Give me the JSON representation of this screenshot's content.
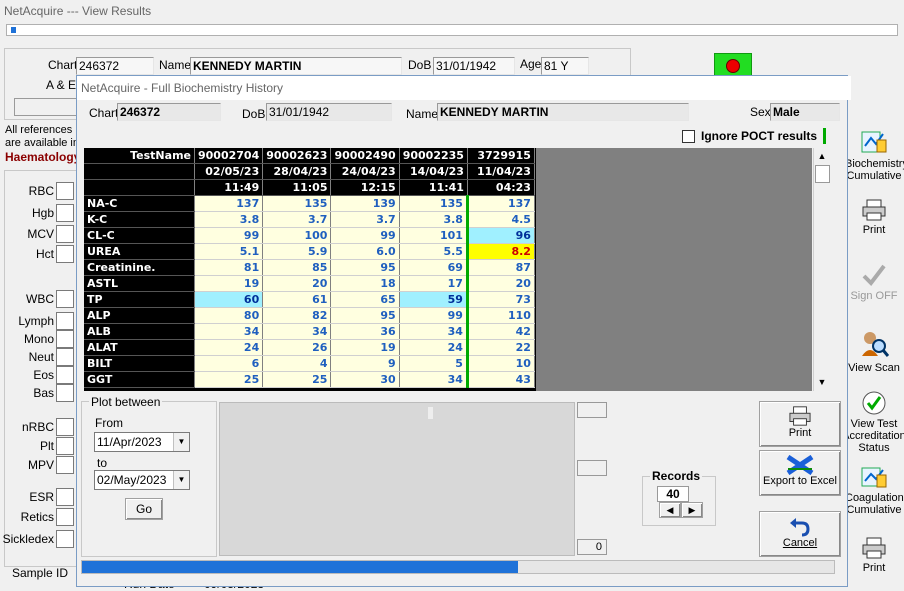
{
  "main_window": {
    "title": "NetAcquire --- View Results",
    "chart_label": "Chart",
    "chart_value": "246372",
    "name_label": "Name",
    "name_value": "KENNEDY MARTIN",
    "dob_label": "DoB",
    "dob_value": "31/01/1942",
    "age_label": "Age",
    "age_value": "81 Y",
    "ae_label": "A & E",
    "refs_line1": "All references n",
    "refs_line2": "are available in",
    "haematology_label": "Haematology",
    "haem_labels": [
      "RBC",
      "Hgb",
      "MCV",
      "Hct",
      "WBC",
      "Lymph",
      "Mono",
      "Neut",
      "Eos",
      "Bas",
      "nRBC",
      "Plt",
      "MPV",
      "ESR",
      "Retics",
      "Sickledex"
    ],
    "sample_id_label": "Sample ID",
    "run_date_label": "Run Date",
    "run_date_value": "09/05/2023",
    "right_buttons": [
      {
        "label": "Biochemistry Cumulative",
        "icon": "biochemistry-icon"
      },
      {
        "label": "Print",
        "icon": "printer-icon"
      },
      {
        "label": "Sign OFF",
        "icon": "checkmark-icon"
      },
      {
        "label": "View Scan",
        "icon": "magnifier-person-icon"
      },
      {
        "label": "View Test Accreditation Status",
        "icon": "green-check-icon"
      },
      {
        "label": "Coagulation Cumulative",
        "icon": "coagulation-icon"
      },
      {
        "label": "Print",
        "icon": "printer-icon"
      }
    ]
  },
  "dialog": {
    "title": "NetAcquire - Full Biochemistry History",
    "chart_label": "Chart",
    "chart_value": "246372",
    "dob_label": "DoB",
    "dob_value": "31/01/1942",
    "name_label": "Name",
    "name_value": "KENNEDY MARTIN",
    "sex_label": "Sex",
    "sex_value": "Male",
    "ignore_poct_label": "Ignore POCT results",
    "ignore_poct_checked": false,
    "grid": {
      "header_label": "TestName",
      "columns": [
        {
          "sample": "90002704",
          "date": "02/05/23",
          "time": "11:49"
        },
        {
          "sample": "90002623",
          "date": "28/04/23",
          "time": "11:05"
        },
        {
          "sample": "90002490",
          "date": "24/04/23",
          "time": "12:15"
        },
        {
          "sample": "90002235",
          "date": "14/04/23",
          "time": "11:41"
        },
        {
          "sample": "3729915",
          "date": "11/04/23",
          "time": "04:23"
        }
      ],
      "rows": [
        {
          "name": "NA-C",
          "values": [
            "137",
            "135",
            "139",
            "135",
            "137"
          ]
        },
        {
          "name": "K-C",
          "values": [
            "3.8",
            "3.7",
            "3.7",
            "3.8",
            "4.5"
          ]
        },
        {
          "name": "CL-C",
          "values": [
            "99",
            "100",
            "99",
            "101",
            "96"
          ]
        },
        {
          "name": "UREA",
          "values": [
            "5.1",
            "5.9",
            "6.0",
            "5.5",
            "8.2"
          ]
        },
        {
          "name": "Creatinine.",
          "values": [
            "81",
            "85",
            "95",
            "69",
            "87"
          ]
        },
        {
          "name": "ASTL",
          "values": [
            "19",
            "20",
            "18",
            "17",
            "20"
          ]
        },
        {
          "name": "TP",
          "values": [
            "60",
            "61",
            "65",
            "59",
            "73"
          ]
        },
        {
          "name": "ALP",
          "values": [
            "80",
            "82",
            "95",
            "99",
            "110"
          ]
        },
        {
          "name": "ALB",
          "values": [
            "34",
            "34",
            "36",
            "34",
            "42"
          ]
        },
        {
          "name": "ALAT",
          "values": [
            "24",
            "26",
            "19",
            "24",
            "22"
          ]
        },
        {
          "name": "BILT",
          "values": [
            "6",
            "4",
            "9",
            "5",
            "10"
          ]
        },
        {
          "name": "GGT",
          "values": [
            "25",
            "25",
            "30",
            "34",
            "43"
          ]
        }
      ],
      "highlight_colors": {
        "low": "#a0f0ff",
        "high": "#ffff00",
        "normal": "#ffffe0"
      }
    },
    "plot_between_label": "Plot between",
    "from_label": "From",
    "from_value": "11/Apr/2023",
    "to_label": "to",
    "to_value": "02/May/2023",
    "go_label": "Go",
    "counter_value": "0",
    "records_label": "Records",
    "records_value": "40",
    "print_label": "Print",
    "export_label": "Export to Excel",
    "cancel_label": "Cancel",
    "progress_fraction": 0.58
  }
}
